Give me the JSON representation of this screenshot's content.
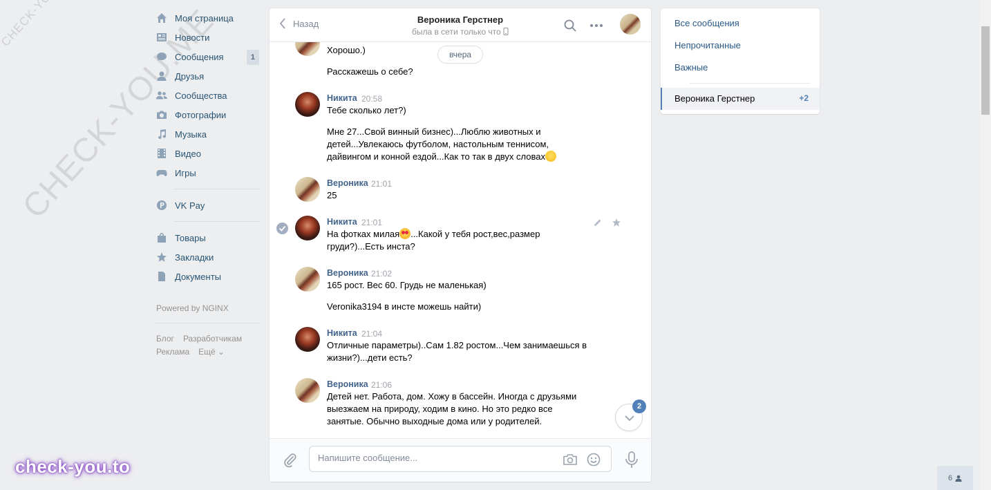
{
  "leftnav": {
    "items": [
      {
        "label": "Моя страница",
        "icon": "home-icon"
      },
      {
        "label": "Новости",
        "icon": "news-icon"
      },
      {
        "label": "Сообщения",
        "icon": "messages-icon",
        "count": "1"
      },
      {
        "label": "Друзья",
        "icon": "friends-icon"
      },
      {
        "label": "Сообщества",
        "icon": "communities-icon"
      },
      {
        "label": "Фотографии",
        "icon": "camera-icon"
      },
      {
        "label": "Музыка",
        "icon": "music-icon"
      },
      {
        "label": "Видео",
        "icon": "video-icon"
      },
      {
        "label": "Игры",
        "icon": "games-icon"
      }
    ],
    "vkpay": {
      "label": "VK Pay",
      "icon": "vkpay-icon"
    },
    "items2": [
      {
        "label": "Товары",
        "icon": "bag-icon"
      },
      {
        "label": "Закладки",
        "icon": "star-icon"
      },
      {
        "label": "Документы",
        "icon": "document-icon"
      }
    ],
    "powered": "Powered by NGINX",
    "footer": {
      "blog": "Блог",
      "dev": "Разработчикам",
      "ads": "Реклама",
      "more": "Ещё ⌄"
    }
  },
  "watermarks": {
    "small": "CHECK-YOU.ME",
    "large": "CHECK-YOU.ME",
    "brand": "check-you.to"
  },
  "chat": {
    "back_label": "Назад",
    "title": "Вероника Герстнер",
    "status": "была в сети только что",
    "date_pill": "вчера",
    "messages": [
      {
        "author": "",
        "time": "",
        "lines": [
          "Хорошо.)",
          "Расскажешь о себе?"
        ]
      },
      {
        "author": "Никита",
        "time": "20:58",
        "line1": "Тебе сколько лет?)",
        "line2": "Мне 27...Свой винный бизнес)...Люблю животных и детей...Увлекаюсь футболом, настольным теннисом, дайвингом и конной ездой...Как то так в двух словах"
      },
      {
        "author": "Вероника",
        "time": "21:01",
        "line1": "25"
      },
      {
        "author": "Никита",
        "time": "21:01",
        "line1a": "На фотках милая",
        "line1b": "...Какой у тебя рост,вес,размер груди?)...Есть инста?"
      },
      {
        "author": "Вероника",
        "time": "21:02",
        "line1": "165 рост. Вес 60. Грудь не маленькая)",
        "line2": "Veronika3194 в инсте можешь найти)"
      },
      {
        "author": "Никита",
        "time": "21:04",
        "line1": "Отличные параметры)..Сам 1.82 ростом...Чем занимаешься в жизни?)...дети есть?"
      },
      {
        "author": "Вероника",
        "time": "21:06",
        "line1": "Детей нет. Работа, дом. Хожу в бассейн. Иногда с друзьями выезжаем на природу, ходим в кино. Но это редко все занятые. Обычно выходные дома или у родителей."
      }
    ],
    "unread_badge": "2",
    "composer": {
      "placeholder": "Напишите сообщение..."
    }
  },
  "rightpanel": {
    "all": "Все сообщения",
    "unread": "Непрочитанные",
    "important": "Важные",
    "active_name": "Вероника Герстнер",
    "active_count": "+2"
  },
  "online": {
    "count": "6"
  },
  "colors": {
    "link": "#2a5885",
    "author": "#42648b",
    "accent": "#5181b8",
    "bg": "#edeef0"
  }
}
